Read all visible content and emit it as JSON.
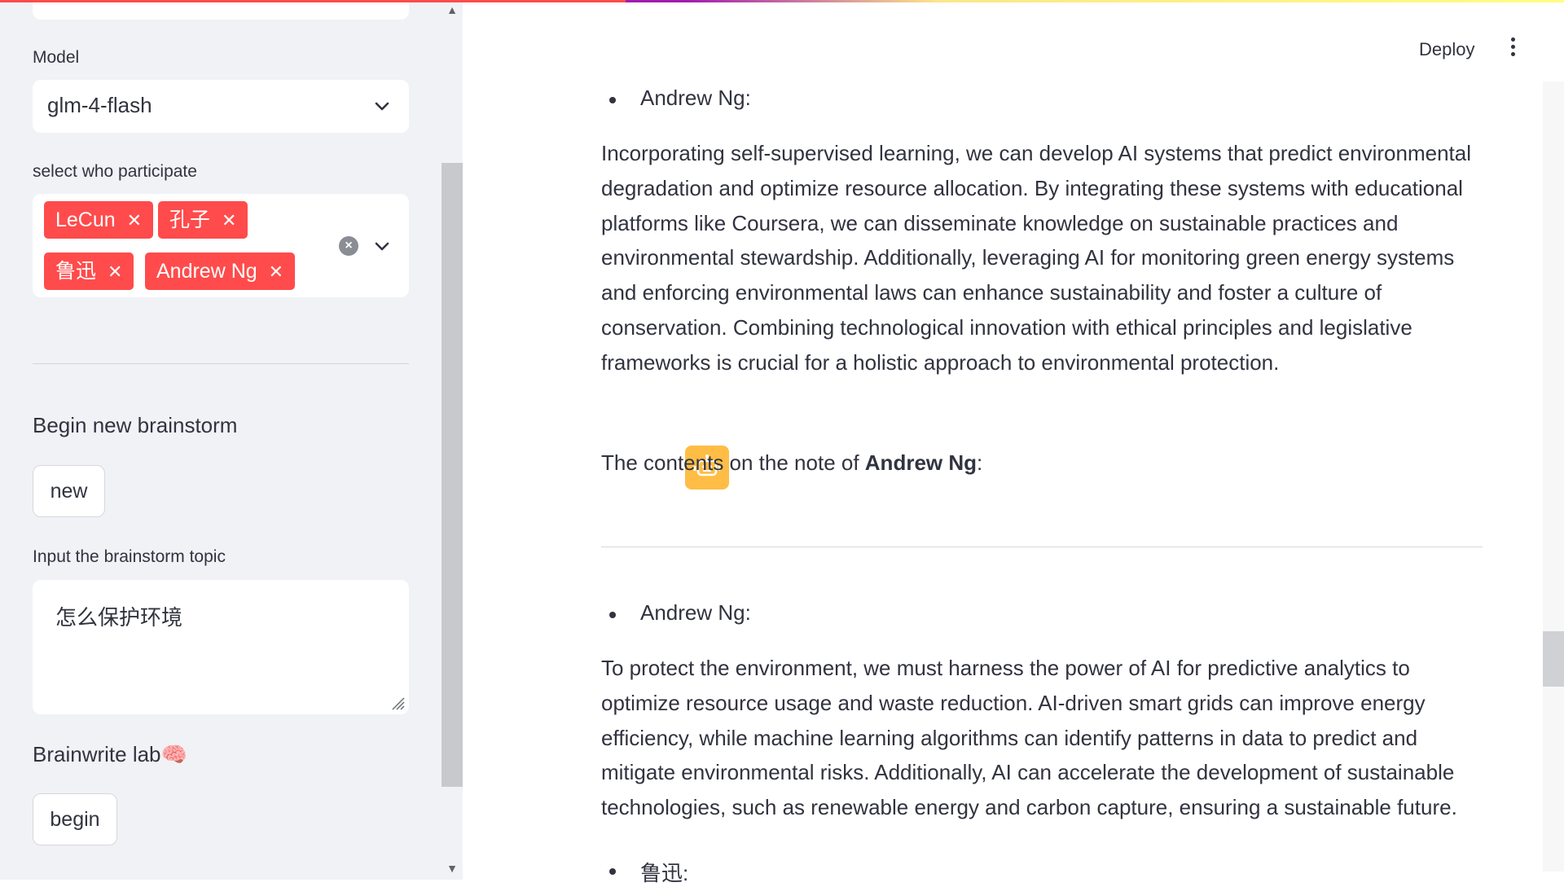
{
  "sidebar": {
    "model_label": "Model",
    "model_value": "glm-4-flash",
    "participants_label": "select who participate",
    "participants": [
      "LeCun",
      "孔子",
      "鲁迅",
      "Andrew Ng"
    ],
    "begin_new_heading": "Begin new brainstorm",
    "new_button": "new",
    "topic_label": "Input the brainstorm topic",
    "topic_value": "怎么保护环境",
    "lab_heading": "Brainwrite lab🧠",
    "begin_button": "begin"
  },
  "header": {
    "deploy_label": "Deploy"
  },
  "chat": {
    "bullet1": "Andrew Ng:",
    "para1": "Incorporating self-supervised learning, we can develop AI systems that predict environmental degradation and optimize resource allocation. By integrating these systems with educational platforms like Coursera, we can disseminate knowledge on sustainable practices and environmental stewardship. Additionally, leveraging AI for monitoring green energy systems and enforcing environmental laws can enhance sustainability and foster a culture of conservation. Combining technological innovation with ethical principles and legislative frameworks is crucial for a holistic approach to environmental protection.",
    "note_prefix": "The contents on the note of ",
    "note_name": "Andrew Ng",
    "note_suffix": ":",
    "bullet2": "Andrew Ng:",
    "para2": "To protect the environment, we must harness the power of AI for predictive analytics to optimize resource usage and waste reduction. AI-driven smart grids can improve energy efficiency, while machine learning algorithms can identify patterns in data to predict and mitigate environmental risks. Additionally, AI can accelerate the development of sustainable technologies, such as renewable energy and carbon capture, ensuring a sustainable future.",
    "bullet3": "鲁迅:"
  },
  "colors": {
    "accent": "#ff4b4b",
    "avatar": "#ffbd45",
    "sidebar_bg": "#f0f2f6"
  }
}
